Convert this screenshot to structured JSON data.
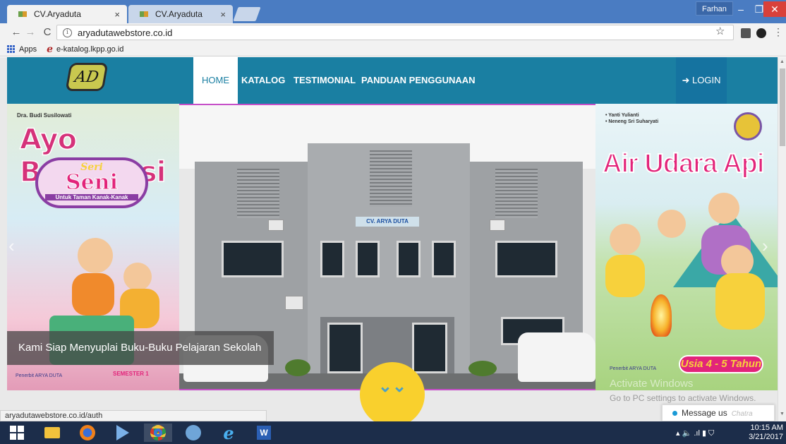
{
  "browser": {
    "tabs": [
      {
        "label": "CV.Aryaduta",
        "active": true
      },
      {
        "label": "CV.Aryaduta",
        "active": false
      }
    ],
    "tab_close": "×",
    "user": "Farhan",
    "window_controls": {
      "minimize": "–",
      "maximize": "❐",
      "close": "✕"
    },
    "nav": {
      "back": "←",
      "forward": "→",
      "reload": "C"
    },
    "info_glyph": "i",
    "url": "aryadutawebstore.co.id",
    "star": "☆",
    "menu": "⋮",
    "bookmarks": [
      {
        "label": "Apps",
        "icon": "apps-grid-icon"
      },
      {
        "label": "e-katalog.lkpp.go.id",
        "icon": "e-katalog-icon"
      }
    ],
    "e_glyph": "e",
    "status_url": "aryadutawebstore.co.id/auth"
  },
  "site": {
    "logo": "AD",
    "nav": [
      {
        "label": "HOME",
        "active": true
      },
      {
        "label": "KATALOG",
        "active": false
      },
      {
        "label": "TESTIMONIAL",
        "active": false
      },
      {
        "label": "PANDUAN PENGGUNAAN",
        "active": false
      }
    ],
    "login": "LOGIN",
    "login_glyph": "➜",
    "carousel": {
      "caption": "Kami Siap Menyuplai Buku-Buku Pelajaran Sekolah",
      "prev_glyph": "‹",
      "next_glyph": "›",
      "scroll_down_glyph": "⌄⌄",
      "left_book": {
        "author": "Dra. Budi Susilowati",
        "title": "Ayo Berkreasi",
        "series": "Seri",
        "subject": "Seni",
        "audience": "Untuk Taman Kanak-Kanak",
        "semester": "SEMESTER 1",
        "publisher": "Penerbit ARYA DUTA"
      },
      "center": {
        "sign": "CV. ARYA DUTA"
      },
      "right_book": {
        "authors": [
          "• Yanti Yulianti",
          "• Neneng Sri Suharyati"
        ],
        "title": "Air Udara Api",
        "age": "Usia 4 - 5 Tahun",
        "publisher": "Penerbit ARYA DUTA"
      }
    },
    "chat": {
      "label": "Message us",
      "brand": "Chatra"
    }
  },
  "windows": {
    "activate_title": "Activate Windows",
    "activate_sub": "Go to PC settings to activate Windows.",
    "clock_time": "10:15 AM",
    "clock_date": "3/21/2017",
    "tray_icons": "▴ 🔈 .ıl ▮ ⛉",
    "taskbar_apps": [
      {
        "name": "start-button"
      },
      {
        "name": "file-explorer"
      },
      {
        "name": "firefox"
      },
      {
        "name": "media-app"
      },
      {
        "name": "chrome"
      },
      {
        "name": "utility-app"
      },
      {
        "name": "internet-explorer"
      },
      {
        "name": "word"
      }
    ]
  },
  "colors": {
    "navbar": "#1a7fa2",
    "accent_yellow": "#f9d02d",
    "accent_pink": "#e2247a",
    "tab_strip": "#4a7cc2"
  }
}
